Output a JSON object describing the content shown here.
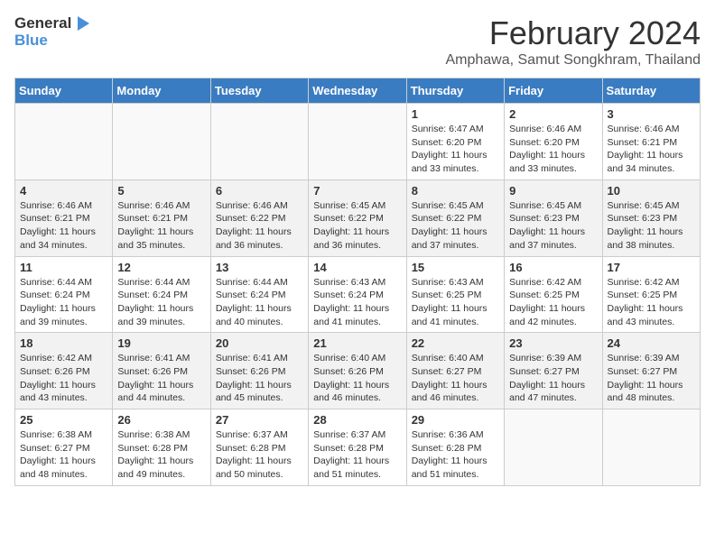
{
  "logo": {
    "general": "General",
    "blue": "Blue"
  },
  "header": {
    "title": "February 2024",
    "subtitle": "Amphawa, Samut Songkhram, Thailand"
  },
  "days_of_week": [
    "Sunday",
    "Monday",
    "Tuesday",
    "Wednesday",
    "Thursday",
    "Friday",
    "Saturday"
  ],
  "weeks": [
    [
      {
        "day": "",
        "info": ""
      },
      {
        "day": "",
        "info": ""
      },
      {
        "day": "",
        "info": ""
      },
      {
        "day": "",
        "info": ""
      },
      {
        "day": "1",
        "info": "Sunrise: 6:47 AM\nSunset: 6:20 PM\nDaylight: 11 hours and 33 minutes."
      },
      {
        "day": "2",
        "info": "Sunrise: 6:46 AM\nSunset: 6:20 PM\nDaylight: 11 hours and 33 minutes."
      },
      {
        "day": "3",
        "info": "Sunrise: 6:46 AM\nSunset: 6:21 PM\nDaylight: 11 hours and 34 minutes."
      }
    ],
    [
      {
        "day": "4",
        "info": "Sunrise: 6:46 AM\nSunset: 6:21 PM\nDaylight: 11 hours and 34 minutes."
      },
      {
        "day": "5",
        "info": "Sunrise: 6:46 AM\nSunset: 6:21 PM\nDaylight: 11 hours and 35 minutes."
      },
      {
        "day": "6",
        "info": "Sunrise: 6:46 AM\nSunset: 6:22 PM\nDaylight: 11 hours and 36 minutes."
      },
      {
        "day": "7",
        "info": "Sunrise: 6:45 AM\nSunset: 6:22 PM\nDaylight: 11 hours and 36 minutes."
      },
      {
        "day": "8",
        "info": "Sunrise: 6:45 AM\nSunset: 6:22 PM\nDaylight: 11 hours and 37 minutes."
      },
      {
        "day": "9",
        "info": "Sunrise: 6:45 AM\nSunset: 6:23 PM\nDaylight: 11 hours and 37 minutes."
      },
      {
        "day": "10",
        "info": "Sunrise: 6:45 AM\nSunset: 6:23 PM\nDaylight: 11 hours and 38 minutes."
      }
    ],
    [
      {
        "day": "11",
        "info": "Sunrise: 6:44 AM\nSunset: 6:24 PM\nDaylight: 11 hours and 39 minutes."
      },
      {
        "day": "12",
        "info": "Sunrise: 6:44 AM\nSunset: 6:24 PM\nDaylight: 11 hours and 39 minutes."
      },
      {
        "day": "13",
        "info": "Sunrise: 6:44 AM\nSunset: 6:24 PM\nDaylight: 11 hours and 40 minutes."
      },
      {
        "day": "14",
        "info": "Sunrise: 6:43 AM\nSunset: 6:24 PM\nDaylight: 11 hours and 41 minutes."
      },
      {
        "day": "15",
        "info": "Sunrise: 6:43 AM\nSunset: 6:25 PM\nDaylight: 11 hours and 41 minutes."
      },
      {
        "day": "16",
        "info": "Sunrise: 6:42 AM\nSunset: 6:25 PM\nDaylight: 11 hours and 42 minutes."
      },
      {
        "day": "17",
        "info": "Sunrise: 6:42 AM\nSunset: 6:25 PM\nDaylight: 11 hours and 43 minutes."
      }
    ],
    [
      {
        "day": "18",
        "info": "Sunrise: 6:42 AM\nSunset: 6:26 PM\nDaylight: 11 hours and 43 minutes."
      },
      {
        "day": "19",
        "info": "Sunrise: 6:41 AM\nSunset: 6:26 PM\nDaylight: 11 hours and 44 minutes."
      },
      {
        "day": "20",
        "info": "Sunrise: 6:41 AM\nSunset: 6:26 PM\nDaylight: 11 hours and 45 minutes."
      },
      {
        "day": "21",
        "info": "Sunrise: 6:40 AM\nSunset: 6:26 PM\nDaylight: 11 hours and 46 minutes."
      },
      {
        "day": "22",
        "info": "Sunrise: 6:40 AM\nSunset: 6:27 PM\nDaylight: 11 hours and 46 minutes."
      },
      {
        "day": "23",
        "info": "Sunrise: 6:39 AM\nSunset: 6:27 PM\nDaylight: 11 hours and 47 minutes."
      },
      {
        "day": "24",
        "info": "Sunrise: 6:39 AM\nSunset: 6:27 PM\nDaylight: 11 hours and 48 minutes."
      }
    ],
    [
      {
        "day": "25",
        "info": "Sunrise: 6:38 AM\nSunset: 6:27 PM\nDaylight: 11 hours and 48 minutes."
      },
      {
        "day": "26",
        "info": "Sunrise: 6:38 AM\nSunset: 6:28 PM\nDaylight: 11 hours and 49 minutes."
      },
      {
        "day": "27",
        "info": "Sunrise: 6:37 AM\nSunset: 6:28 PM\nDaylight: 11 hours and 50 minutes."
      },
      {
        "day": "28",
        "info": "Sunrise: 6:37 AM\nSunset: 6:28 PM\nDaylight: 11 hours and 51 minutes."
      },
      {
        "day": "29",
        "info": "Sunrise: 6:36 AM\nSunset: 6:28 PM\nDaylight: 11 hours and 51 minutes."
      },
      {
        "day": "",
        "info": ""
      },
      {
        "day": "",
        "info": ""
      }
    ]
  ]
}
